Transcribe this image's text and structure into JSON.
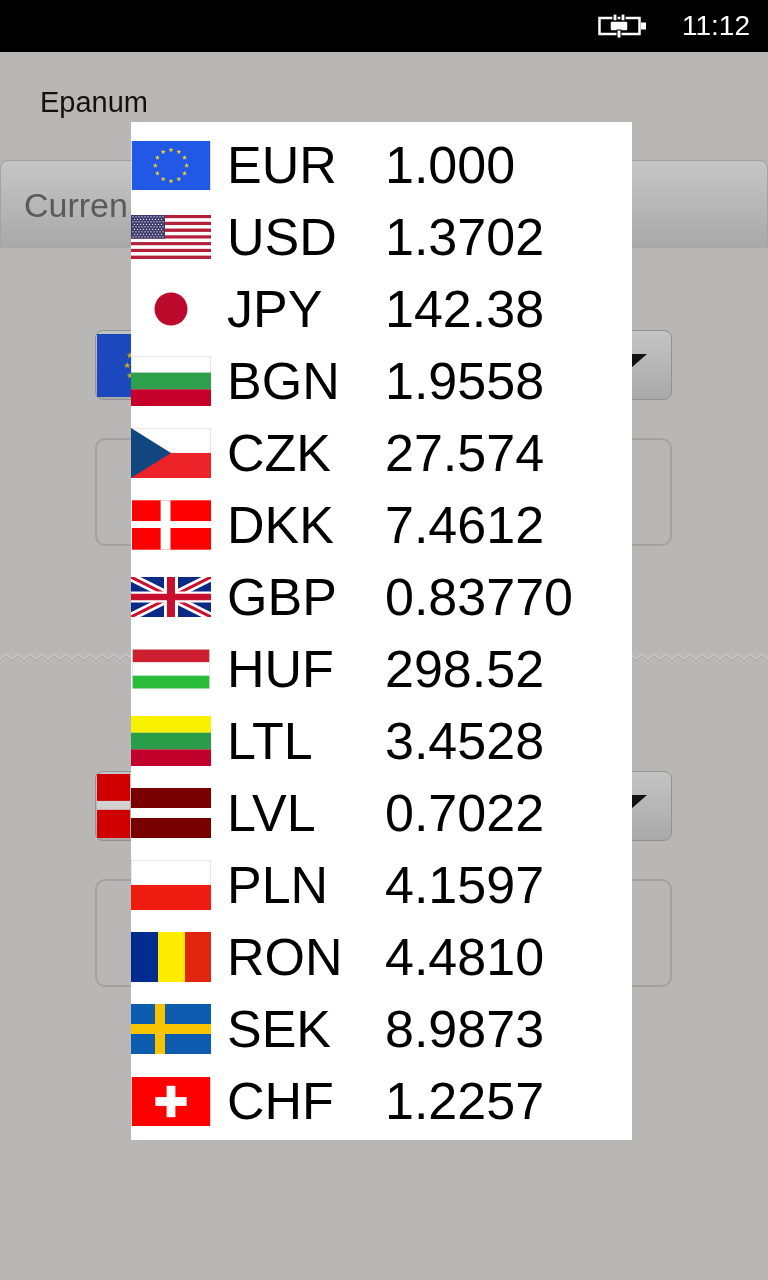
{
  "status_bar": {
    "time": "11:12"
  },
  "app": {
    "title": "Epanum"
  },
  "section": {
    "title": "Curren"
  },
  "converter": {
    "fields": [
      {
        "kind": "dropdown"
      },
      {
        "kind": "input"
      },
      {
        "kind": "divider"
      },
      {
        "kind": "dropdown"
      },
      {
        "kind": "input"
      }
    ]
  },
  "currency_list": {
    "items": [
      {
        "code": "EUR",
        "rate": "1.000"
      },
      {
        "code": "USD",
        "rate": "1.3702"
      },
      {
        "code": "JPY",
        "rate": "142.38"
      },
      {
        "code": "BGN",
        "rate": "1.9558"
      },
      {
        "code": "CZK",
        "rate": "27.574"
      },
      {
        "code": "DKK",
        "rate": "7.4612"
      },
      {
        "code": "GBP",
        "rate": "0.83770"
      },
      {
        "code": "HUF",
        "rate": "298.52"
      },
      {
        "code": "LTL",
        "rate": "3.4528"
      },
      {
        "code": "LVL",
        "rate": "0.7022"
      },
      {
        "code": "PLN",
        "rate": "4.1597"
      },
      {
        "code": "RON",
        "rate": "4.4810"
      },
      {
        "code": "SEK",
        "rate": "8.9873"
      },
      {
        "code": "CHF",
        "rate": "1.2257"
      }
    ]
  }
}
